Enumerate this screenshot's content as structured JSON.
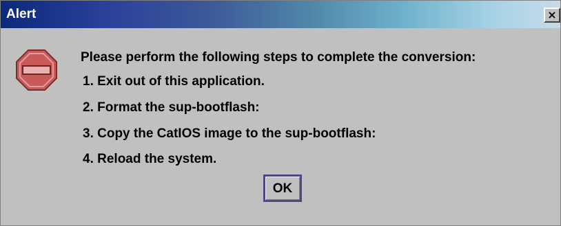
{
  "window": {
    "title": "Alert",
    "close_label": "×"
  },
  "icon": {
    "name": "stop-icon",
    "color": "#c85a5a"
  },
  "message": {
    "lines": [
      "Please perform the following steps to complete the conversion:",
      "1. Exit out of this application.",
      "2. Format the sup-bootflash:",
      "3. Copy the CatIOS image to the sup-bootflash:",
      "4. Reload the system."
    ]
  },
  "buttons": {
    "ok_label": "OK"
  },
  "colors": {
    "dialog_bg": "#c0c0c0",
    "title_text": "#ffffff",
    "titlebar_start": "#0a2a7a",
    "titlebar_end": "#c7dbe9",
    "ok_border": "#4a4a8a"
  }
}
